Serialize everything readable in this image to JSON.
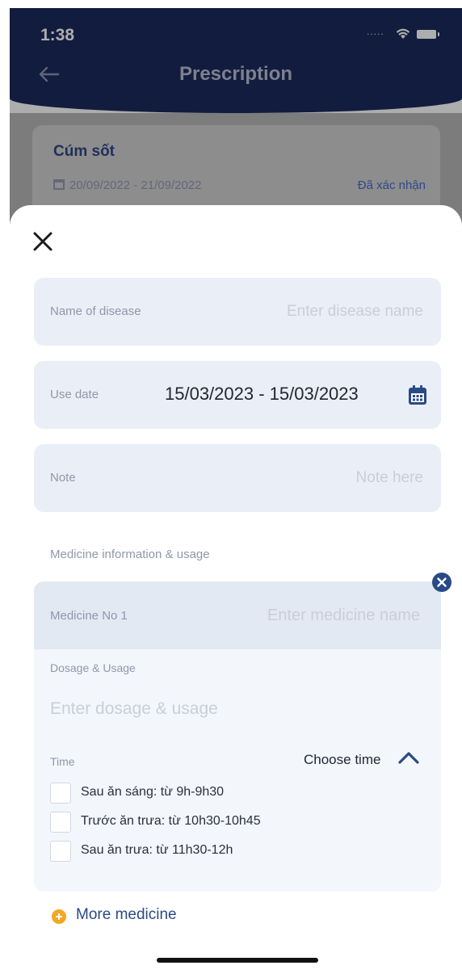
{
  "status_bar": {
    "time": "1:38",
    "signal_dots": "....."
  },
  "header": {
    "title": "Prescription"
  },
  "background_card": {
    "title": "Cúm sốt",
    "date_range": "20/09/2022 - 21/09/2022",
    "status": "Đã xác nhận"
  },
  "form": {
    "disease": {
      "label": "Name of disease",
      "placeholder": "Enter disease name"
    },
    "use_date": {
      "label": "Use date",
      "value": "15/03/2023 - 15/03/2023"
    },
    "note": {
      "label": "Note",
      "placeholder": "Note here"
    },
    "section_label": "Medicine information & usage",
    "medicine": {
      "label": "Medicine No 1",
      "placeholder": "Enter medicine name",
      "dosage_label": "Dosage & Usage",
      "dosage_placeholder": "Enter dosage & usage",
      "time_label": "Time",
      "choose_time": "Choose time",
      "time_options": [
        {
          "label": "Sau ăn sáng: từ 9h-9h30",
          "checked": false
        },
        {
          "label": "Trước ăn trưa: từ 10h30-10h45",
          "checked": false
        },
        {
          "label": "Sau ăn trưa: từ 11h30-12h",
          "checked": false
        }
      ]
    },
    "more_medicine": "More medicine"
  },
  "colors": {
    "header_bg": "#1b2a5e",
    "field_bg": "#eaeef6",
    "accent_blue": "#2a4a86",
    "plus_orange": "#f5a623"
  },
  "icons": [
    "back-arrow-icon",
    "wifi-icon",
    "battery-icon",
    "close-icon",
    "calendar-icon",
    "remove-circle-icon",
    "chevron-up-icon",
    "plus-circle-icon"
  ]
}
